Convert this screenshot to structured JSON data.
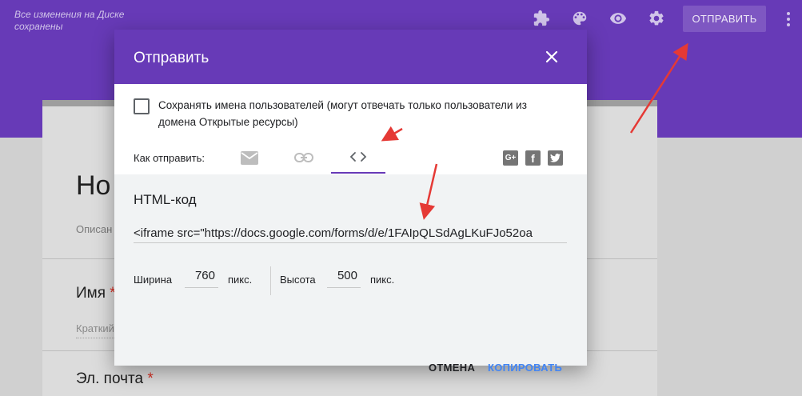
{
  "app": {
    "save_status": "Все изменения на Диске сохранены",
    "send_button": "ОТПРАВИТЬ",
    "toolbar_icons": [
      "puzzle-icon",
      "palette-icon",
      "eye-icon",
      "gear-icon",
      "more-vert-icon"
    ]
  },
  "form": {
    "title": "Но",
    "description": "Описан",
    "questions": [
      {
        "label": "Имя",
        "required": "*",
        "hint": "Краткий"
      },
      {
        "label": "Эл. почта",
        "required": "*"
      }
    ]
  },
  "dialog": {
    "title": "Отправить",
    "collect_emails_label": "Сохранять имена пользователей (могут отвечать только пользователи из домена Открытые ресурсы)",
    "send_via_label": "Как отправить:",
    "tabs": [
      "email-icon",
      "link-icon",
      "embed-code-icon"
    ],
    "active_tab": "embed-code-icon",
    "social": [
      "google-plus-icon",
      "facebook-icon",
      "twitter-icon"
    ],
    "embed": {
      "title": "HTML-код",
      "code": "<iframe src=\"https://docs.google.com/forms/d/e/1FAIpQLSdAgLKuFJo52oa",
      "width_label": "Ширина",
      "width_value": "760",
      "unit": "пикс.",
      "height_label": "Высота",
      "height_value": "500"
    },
    "cancel_label": "ОТМЕНА",
    "copy_label": "КОПИРОВАТЬ"
  },
  "colors": {
    "header": "#673ab7",
    "accent_blue": "#4285f4",
    "arrow_red": "#e53935"
  }
}
